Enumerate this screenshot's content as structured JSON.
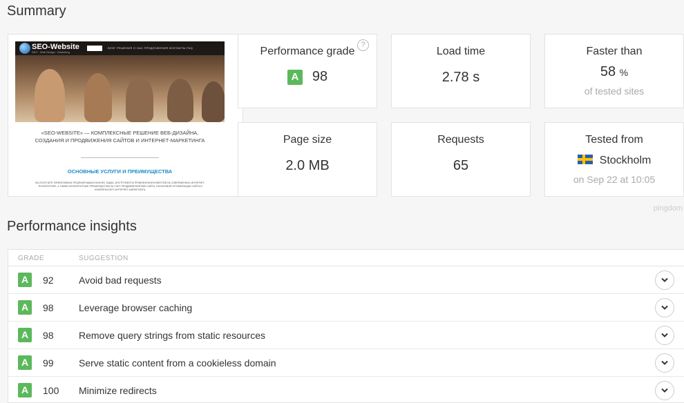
{
  "summary": {
    "heading": "Summary",
    "screenshot": {
      "logo": "SEO-Website",
      "logo_sub": "SEO · Web Design · Marketing",
      "nav_links": "БЛОГ   РЕШЕНИЯ   О НАС   ПРЕДЛОЖЕНИЯ   КОНТАКТЫ   FAQ",
      "headline_1": "«SEO-WEBSITE» — КОМПЛЕКСНЫЕ РЕШЕНИЕ ВЕБ-ДИЗАЙНА,",
      "headline_2": "СОЗДАНИЯ И ПРОДВИЖЕНИЯ САЙТОВ И ИНТЕРНЕТ-МАРКЕТИНГА",
      "subheading": "ОСНОВНЫЕ УСЛУГИ И ПРЕИМУЩЕСТВА",
      "paragraph": "ВЫ ПОЛУЧИТЕ ЭФФЕКТИВНЫЕ РЕШЕНИЯ ВАШИХ БИЗНЕС ЗАДАЧ, ИНСТРУМЕНТЫ ПРИВЛЕЧЕНИЯ КЛИЕНТОВ НА СОВРЕМЕННЫХ ИНТЕРНЕТ-ТЕХНОЛОГИЯХ, А ТАКЖЕ КОНКУРЕНТНЫЕ ПРЕИМУЩЕСТВА ЗА СЧЕТ ПРОДВИЖЕНИЯ ВЕБ-САЙТА, ПОИСКОВОЙ ОПТИМИЗАЦИИ САЙТА И КОМПЛЕКСНОГО ИНТЕРНЕТ-МАРКЕТИНГА."
    },
    "performance": {
      "label": "Performance grade",
      "grade": "A",
      "score": "98",
      "help_icon": "?"
    },
    "load_time": {
      "label": "Load time",
      "value": "2.78 s"
    },
    "faster_than": {
      "label": "Faster than",
      "value": "58",
      "unit": "%",
      "sub": "of tested sites"
    },
    "page_size": {
      "label": "Page size",
      "value": "2.0 MB"
    },
    "requests": {
      "label": "Requests",
      "value": "65"
    },
    "tested_from": {
      "label": "Tested from",
      "location": "Stockholm",
      "date": "on Sep 22 at 10:05",
      "flag_icon": "sweden-flag-icon"
    },
    "brand": "pingdom"
  },
  "insights": {
    "heading": "Performance insights",
    "columns": {
      "grade": "GRADE",
      "suggestion": "SUGGESTION"
    },
    "rows": [
      {
        "grade": "A",
        "score": "92",
        "suggestion": "Avoid bad requests"
      },
      {
        "grade": "A",
        "score": "98",
        "suggestion": "Leverage browser caching"
      },
      {
        "grade": "A",
        "score": "98",
        "suggestion": "Remove query strings from static resources"
      },
      {
        "grade": "A",
        "score": "99",
        "suggestion": "Serve static content from a cookieless domain"
      },
      {
        "grade": "A",
        "score": "100",
        "suggestion": "Minimize redirects"
      }
    ]
  },
  "colors": {
    "grade_a": "#5cb85c",
    "background": "#f6f6f6"
  }
}
